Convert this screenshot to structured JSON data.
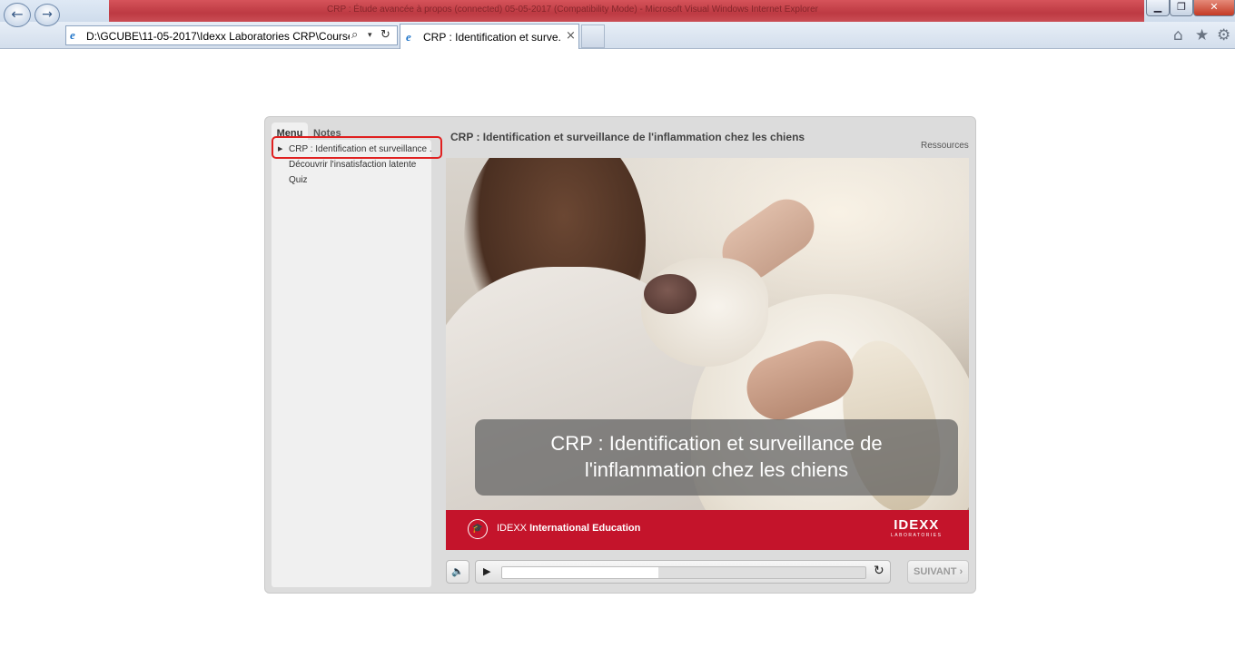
{
  "window": {
    "title": "CRP : Étude avancée à propos (connected) 05-05-2017 (Compatibility Mode) - Microsoft Visual Windows Internet Explorer"
  },
  "browser": {
    "address": "D:\\GCUBE\\11-05-2017\\Idexx Laboratories CRP\\Course\\",
    "tab_title": "CRP : Identification et surve...",
    "tab_close": "×"
  },
  "course": {
    "title": "CRP : Identification et surveillance de l'inflammation chez les chiens",
    "resources_label": "Ressources",
    "sidebar": {
      "tab_menu": "Menu",
      "tab_notes": "Notes",
      "items": [
        "CRP : Identification et surveillance ...",
        "Découvrir l'insatisfaction latente",
        "Quiz"
      ]
    },
    "slide": {
      "caption_line1": "CRP : Identification et surveillance de",
      "caption_line2": "l'inflammation chez les chiens",
      "brand_prefix": "IDEXX",
      "brand_suffix": "International Education",
      "logo_text": "IDEXX",
      "logo_sub": "LABORATORIES"
    },
    "controls": {
      "progress_fraction": 0.43,
      "next_label": "SUIVANT ›"
    }
  }
}
